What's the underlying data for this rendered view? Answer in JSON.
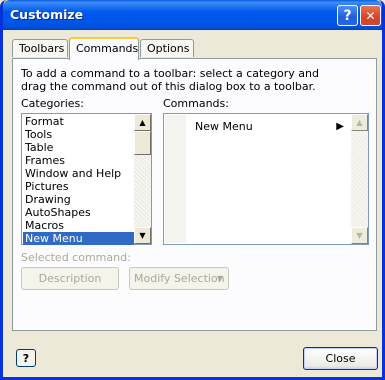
{
  "window": {
    "title": "Customize",
    "help_glyph": "?",
    "close_glyph": "✕"
  },
  "tabs": [
    {
      "label": "Toolbars"
    },
    {
      "label": "Commands"
    },
    {
      "label": "Options"
    }
  ],
  "commands_tab": {
    "instruction": "To add a command to a toolbar: select a category and drag the command out of this dialog box to a toolbar.",
    "categories_label": "Categories:",
    "commands_label": "Commands:",
    "categories": [
      "Format",
      "Tools",
      "Table",
      "Frames",
      "Window and Help",
      "Pictures",
      "Drawing",
      "AutoShapes",
      "Macros",
      "New Menu"
    ],
    "selected_category": "New Menu",
    "commands": [
      {
        "label": "New Menu",
        "submenu_arrow": "▶"
      }
    ],
    "selected_command_label": "Selected command:",
    "description_button": "Description",
    "modify_selection_button": "Modify Selection",
    "modify_caret": "▼"
  },
  "footer": {
    "help_icon_glyph": "?",
    "close_button": "Close"
  },
  "colors": {
    "titlebar": "#0054e3",
    "selection": "#316ac5",
    "dialog_face": "#ece9d8",
    "disabled_text": "#aca899"
  }
}
